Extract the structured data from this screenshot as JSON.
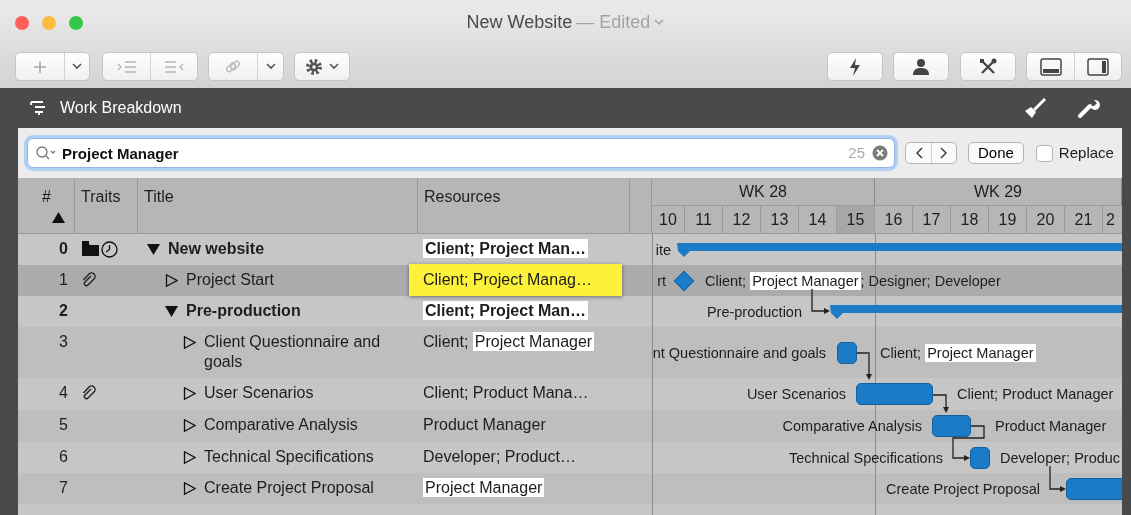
{
  "window": {
    "title": "New Website",
    "status": "— Edited"
  },
  "panel": {
    "title": "Work Breakdown"
  },
  "find_bar": {
    "query": "Project Manager",
    "match_count": "25",
    "done_label": "Done",
    "replace": {
      "label": "Replace",
      "checked": false
    }
  },
  "table": {
    "columns": [
      {
        "label": "#",
        "sorted": true
      },
      {
        "label": "Traits",
        "sorted": false
      },
      {
        "label": "Title",
        "sorted": false
      },
      {
        "label": "Resources",
        "sorted": false
      }
    ]
  },
  "timeline": {
    "weeks": [
      "WK 28",
      "WK 29"
    ],
    "days": [
      {
        "label": "10",
        "weekend": false
      },
      {
        "label": "11",
        "weekend": false
      },
      {
        "label": "12",
        "weekend": false
      },
      {
        "label": "13",
        "weekend": false
      },
      {
        "label": "14",
        "weekend": false
      },
      {
        "label": "15",
        "weekend": true
      },
      {
        "label": "16",
        "weekend": false
      },
      {
        "label": "17",
        "weekend": false
      },
      {
        "label": "18",
        "weekend": false
      },
      {
        "label": "19",
        "weekend": false
      },
      {
        "label": "20",
        "weekend": false
      },
      {
        "label": "21",
        "weekend": false
      },
      {
        "label": "2",
        "weekend": false
      }
    ]
  },
  "rows": [
    {
      "number": "0",
      "kind": "project",
      "expanded": true,
      "selected": false,
      "attachment": false,
      "title": "New website",
      "resources": [
        {
          "text": "Client; Project Man…",
          "match": true,
          "current": false
        }
      ],
      "gantt": {
        "label": "ite",
        "kind": "summary"
      },
      "children": [
        {
          "number": "1",
          "kind": "task",
          "expanded": false,
          "selected": true,
          "attachment": true,
          "title": "Project Start",
          "resources": [
            {
              "text": "Client; Project Manag…",
              "match": true,
              "current": true
            }
          ],
          "gantt": {
            "label": "rt",
            "kind": "milestone",
            "resources": [
              {
                "text": "Client; ",
                "match": false,
                "current": false
              },
              {
                "text": "Project Manager",
                "match": true,
                "current": false
              },
              {
                "text": "; Designer; Developer",
                "match": false,
                "current": false
              }
            ]
          }
        },
        {
          "number": "2",
          "kind": "group",
          "expanded": true,
          "selected": false,
          "attachment": false,
          "title": "Pre-production",
          "resources": [
            {
              "text": "Client; Project Man…",
              "match": true,
              "current": false
            }
          ],
          "gantt": {
            "label": "Pre-production",
            "kind": "summary",
            "linked": true
          },
          "children": [
            {
              "number": "3",
              "kind": "task",
              "expanded": false,
              "selected": false,
              "attachment": false,
              "title": "Client Questionnaire and goals",
              "resources": [
                {
                  "text": "Client; ",
                  "match": false,
                  "current": false
                },
                {
                  "text": "Project Manager",
                  "match": true,
                  "current": false
                }
              ],
              "gantt": {
                "label": "nt Questionnaire and goals",
                "kind": "task",
                "resources": [
                  {
                    "text": "Client; ",
                    "match": false,
                    "current": false
                  },
                  {
                    "text": "Project Manager",
                    "match": true,
                    "current": false
                  }
                ]
              }
            },
            {
              "number": "4",
              "kind": "task",
              "expanded": false,
              "selected": false,
              "attachment": true,
              "title": "User Scenarios",
              "resources": [
                {
                  "text": "Client; Product Mana…",
                  "match": false,
                  "current": false
                }
              ],
              "gantt": {
                "label": "User Scenarios",
                "kind": "task",
                "linked": true,
                "resources": [
                  {
                    "text": "Client; Product Manager",
                    "match": false,
                    "current": false
                  }
                ]
              }
            },
            {
              "number": "5",
              "kind": "task",
              "expanded": false,
              "selected": false,
              "attachment": false,
              "title": "Comparative Analysis",
              "resources": [
                {
                  "text": "Product Manager",
                  "match": false,
                  "current": false
                }
              ],
              "gantt": {
                "label": "Comparative Analysis",
                "kind": "task",
                "linked": true,
                "resources": [
                  {
                    "text": "Product Manager",
                    "match": false,
                    "current": false
                  }
                ]
              }
            },
            {
              "number": "6",
              "kind": "task",
              "expanded": false,
              "selected": false,
              "attachment": false,
              "title": "Technical Specifications",
              "resources": [
                {
                  "text": "Developer; Product…",
                  "match": false,
                  "current": false
                }
              ],
              "gantt": {
                "label": "Technical Specifications",
                "kind": "task",
                "linked": true,
                "resources": [
                  {
                    "text": "Developer; Produc",
                    "match": false,
                    "current": false
                  }
                ]
              }
            },
            {
              "number": "7",
              "kind": "task",
              "expanded": false,
              "selected": false,
              "attachment": false,
              "title": "Create Project Proposal",
              "resources": [
                {
                  "text": "Project Manager",
                  "match": true,
                  "current": false
                }
              ],
              "gantt": {
                "label": "Create Project Proposal",
                "kind": "task",
                "linked": true
              }
            }
          ]
        }
      ]
    }
  ]
}
